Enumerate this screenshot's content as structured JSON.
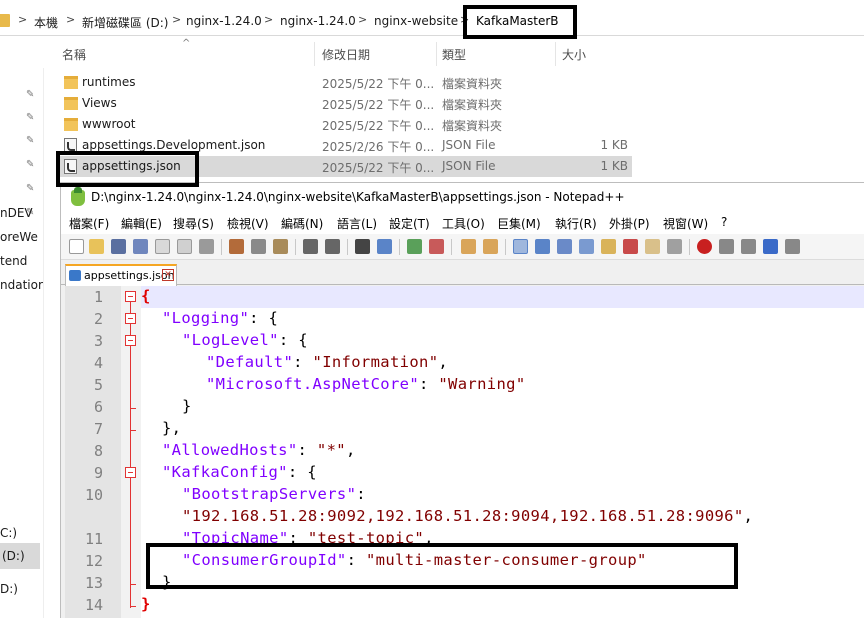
{
  "explorer": {
    "breadcrumb": [
      "本機",
      "新增磁碟區 (D:)",
      "nginx-1.24.0",
      "nginx-1.24.0",
      "nginx-website",
      "KafkaMasterB"
    ],
    "columns": {
      "name": "名稱",
      "date": "修改日期",
      "type": "類型",
      "size": "大小"
    },
    "files": [
      {
        "name": "runtimes",
        "date": "2025/5/22 下午 0...",
        "type": "檔案資料夾",
        "size": "",
        "kind": "folder"
      },
      {
        "name": "Views",
        "date": "2025/5/22 下午 0...",
        "type": "檔案資料夾",
        "size": "",
        "kind": "folder"
      },
      {
        "name": "wwwroot",
        "date": "2025/5/22 下午 0...",
        "type": "檔案資料夾",
        "size": "",
        "kind": "folder"
      },
      {
        "name": "appsettings.Development.json",
        "date": "2025/2/26 下午 0...",
        "type": "JSON File",
        "size": "1 KB",
        "kind": "json"
      },
      {
        "name": "appsettings.json",
        "date": "2025/5/22 下午 0...",
        "type": "JSON File",
        "size": "1 KB",
        "kind": "json"
      }
    ],
    "nav": [
      "nDEV",
      "oreWe",
      "tend",
      "ndatior",
      "C:)",
      "(D:)",
      "D:)"
    ]
  },
  "npp": {
    "title": "D:\\nginx-1.24.0\\nginx-1.24.0\\nginx-website\\KafkaMasterB\\appsettings.json - Notepad++",
    "menu": [
      "檔案(F)",
      "編輯(E)",
      "搜尋(S)",
      "檢視(V)",
      "編碼(N)",
      "語言(L)",
      "設定(T)",
      "工具(O)",
      "巨集(M)",
      "執行(R)",
      "外掛(P)",
      "視窗(W)",
      "?"
    ],
    "tab": "appsettings.json",
    "line_numbers": [
      "1",
      "2",
      "3",
      "4",
      "5",
      "6",
      "7",
      "8",
      "9",
      "10",
      "",
      "11",
      "12",
      "13",
      "14"
    ],
    "code": {
      "l1": "{",
      "l2k": "\"Logging\"",
      "l2p": ": {",
      "l3k": "\"LogLevel\"",
      "l3p": ": {",
      "l4k": "\"Default\"",
      "l4p": ": ",
      "l4s": "\"Information\"",
      "l4e": ",",
      "l5k": "\"Microsoft.AspNetCore\"",
      "l5p": ": ",
      "l5s": "\"Warning\"",
      "l6": "}",
      "l7": "},",
      "l8k": "\"AllowedHosts\"",
      "l8p": ": ",
      "l8s": "\"*\"",
      "l8e": ",",
      "l9k": "\"KafkaConfig\"",
      "l9p": ": {",
      "l10k": "\"BootstrapServers\"",
      "l10p": ":",
      "l10s": "\"192.168.51.28:9092,192.168.51.28:9094,192.168.51.28:9096\"",
      "l10e": ",",
      "l11k": "\"TopicName\"",
      "l11p": ": ",
      "l11s": "\"test-topic\"",
      "l11e": ",",
      "l12k": "\"ConsumerGroupId\"",
      "l12p": ": ",
      "l12s": "\"multi-master-consumer-group\"",
      "l13": "}",
      "l14": "}"
    }
  },
  "colors": {
    "accent_tab": "#f5a623",
    "key": "#8000ff",
    "string": "#800000",
    "fold": "#e23333"
  }
}
